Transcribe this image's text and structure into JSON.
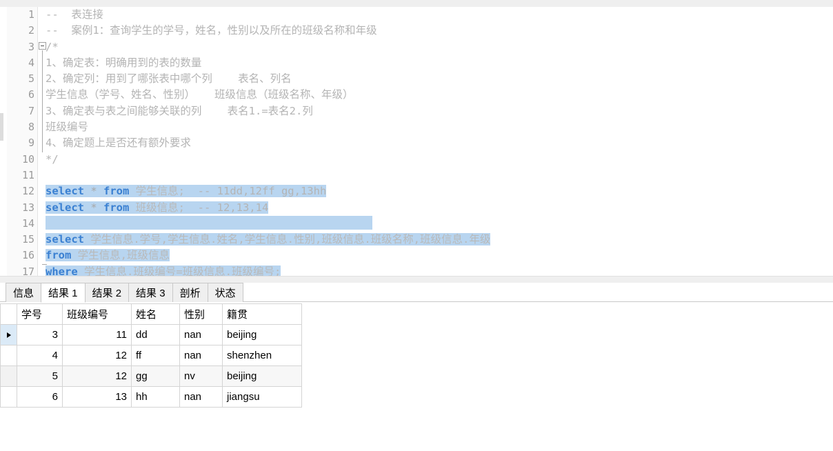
{
  "editor": {
    "language": "sql",
    "lines": [
      {
        "n": 1,
        "segments": [
          {
            "t": "--  表连接",
            "c": "cmt"
          }
        ]
      },
      {
        "n": 2,
        "segments": [
          {
            "t": "--  案例1：查询学生的学号，姓名，性别以及所在的班级名称和年级",
            "c": "cmt"
          }
        ]
      },
      {
        "n": 3,
        "segments": [
          {
            "t": "/*",
            "c": "cmt"
          }
        ],
        "fold": "start"
      },
      {
        "n": 4,
        "segments": [
          {
            "t": "1、确定表：明确用到的表的数量",
            "c": "cmt"
          }
        ]
      },
      {
        "n": 5,
        "segments": [
          {
            "t": "2、确定列：用到了哪张表中哪个列    表名、列名",
            "c": "cmt"
          }
        ]
      },
      {
        "n": 6,
        "segments": [
          {
            "t": "学生信息（学号、姓名、性别）   班级信息（班级名称、年级）",
            "c": "cmt"
          }
        ]
      },
      {
        "n": 7,
        "segments": [
          {
            "t": "3、确定表与表之间能够关联的列    表名1.=表名2.列",
            "c": "cmt"
          }
        ]
      },
      {
        "n": 8,
        "segments": [
          {
            "t": "班级编号",
            "c": "cmt"
          }
        ]
      },
      {
        "n": 9,
        "segments": [
          {
            "t": "4、确定题上是否还有额外要求",
            "c": "cmt"
          }
        ]
      },
      {
        "n": 10,
        "segments": [
          {
            "t": "*/",
            "c": "cmt"
          }
        ],
        "fold": "end"
      },
      {
        "n": 11,
        "segments": []
      },
      {
        "n": 12,
        "selected": true,
        "segments": [
          {
            "t": "select",
            "c": "kw"
          },
          {
            "t": " * ",
            "c": "punct"
          },
          {
            "t": "from",
            "c": "kw"
          },
          {
            "t": " 学生信息;",
            "c": "ident"
          },
          {
            "t": "  -- 11dd,12ff gg,13hh",
            "c": "cmt"
          }
        ]
      },
      {
        "n": 13,
        "selected": true,
        "segments": [
          {
            "t": "select",
            "c": "kw"
          },
          {
            "t": " * ",
            "c": "punct"
          },
          {
            "t": "from",
            "c": "kw"
          },
          {
            "t": " 班级信息;",
            "c": "ident"
          },
          {
            "t": "  -- 12,13,14",
            "c": "cmt"
          }
        ]
      },
      {
        "n": 14,
        "selected": true,
        "selwidth": 474,
        "segments": []
      },
      {
        "n": 15,
        "selected": true,
        "segments": [
          {
            "t": "select",
            "c": "kw"
          },
          {
            "t": " 学生信息.学号,学生信息.姓名,学生信息.性别,班级信息.班级名称,班级信息.年级",
            "c": "ident"
          }
        ]
      },
      {
        "n": 16,
        "selected": true,
        "segments": [
          {
            "t": "from",
            "c": "kw"
          },
          {
            "t": " 学生信息,班级信息",
            "c": "ident"
          }
        ]
      },
      {
        "n": 17,
        "selected": true,
        "segments": [
          {
            "t": "where",
            "c": "kw"
          },
          {
            "t": " 学生信息.班级编号=班级信息.班级编号;",
            "c": "ident"
          }
        ]
      }
    ]
  },
  "result_tabs": [
    {
      "label": "信息",
      "active": false
    },
    {
      "label": "结果 1",
      "active": true
    },
    {
      "label": "结果 2",
      "active": false
    },
    {
      "label": "结果 3",
      "active": false
    },
    {
      "label": "剖析",
      "active": false
    },
    {
      "label": "状态",
      "active": false
    }
  ],
  "grid": {
    "columns": [
      {
        "label": "学号",
        "align": "right",
        "highlighted": true
      },
      {
        "label": "班级编号",
        "align": "right",
        "highlighted": false
      },
      {
        "label": "姓名",
        "align": "left",
        "highlighted": false
      },
      {
        "label": "性别",
        "align": "left",
        "highlighted": false
      },
      {
        "label": "籍贯",
        "align": "left",
        "highlighted": false
      }
    ],
    "rows": [
      {
        "current": true,
        "cells": [
          "3",
          "11",
          "dd",
          "nan",
          "beijing"
        ]
      },
      {
        "current": false,
        "cells": [
          "4",
          "12",
          "ff",
          "nan",
          "shenzhen"
        ]
      },
      {
        "current": false,
        "cells": [
          "5",
          "12",
          "gg",
          "nv",
          "beijing"
        ]
      },
      {
        "current": false,
        "cells": [
          "6",
          "13",
          "hh",
          "nan",
          "jiangsu"
        ]
      }
    ]
  },
  "colors": {
    "keyword": "#3a80d2",
    "comment": "#b4b4b4",
    "selection": "#b8d5f0",
    "header_highlight": "#dbeaf7",
    "chrome": "#efefef"
  }
}
